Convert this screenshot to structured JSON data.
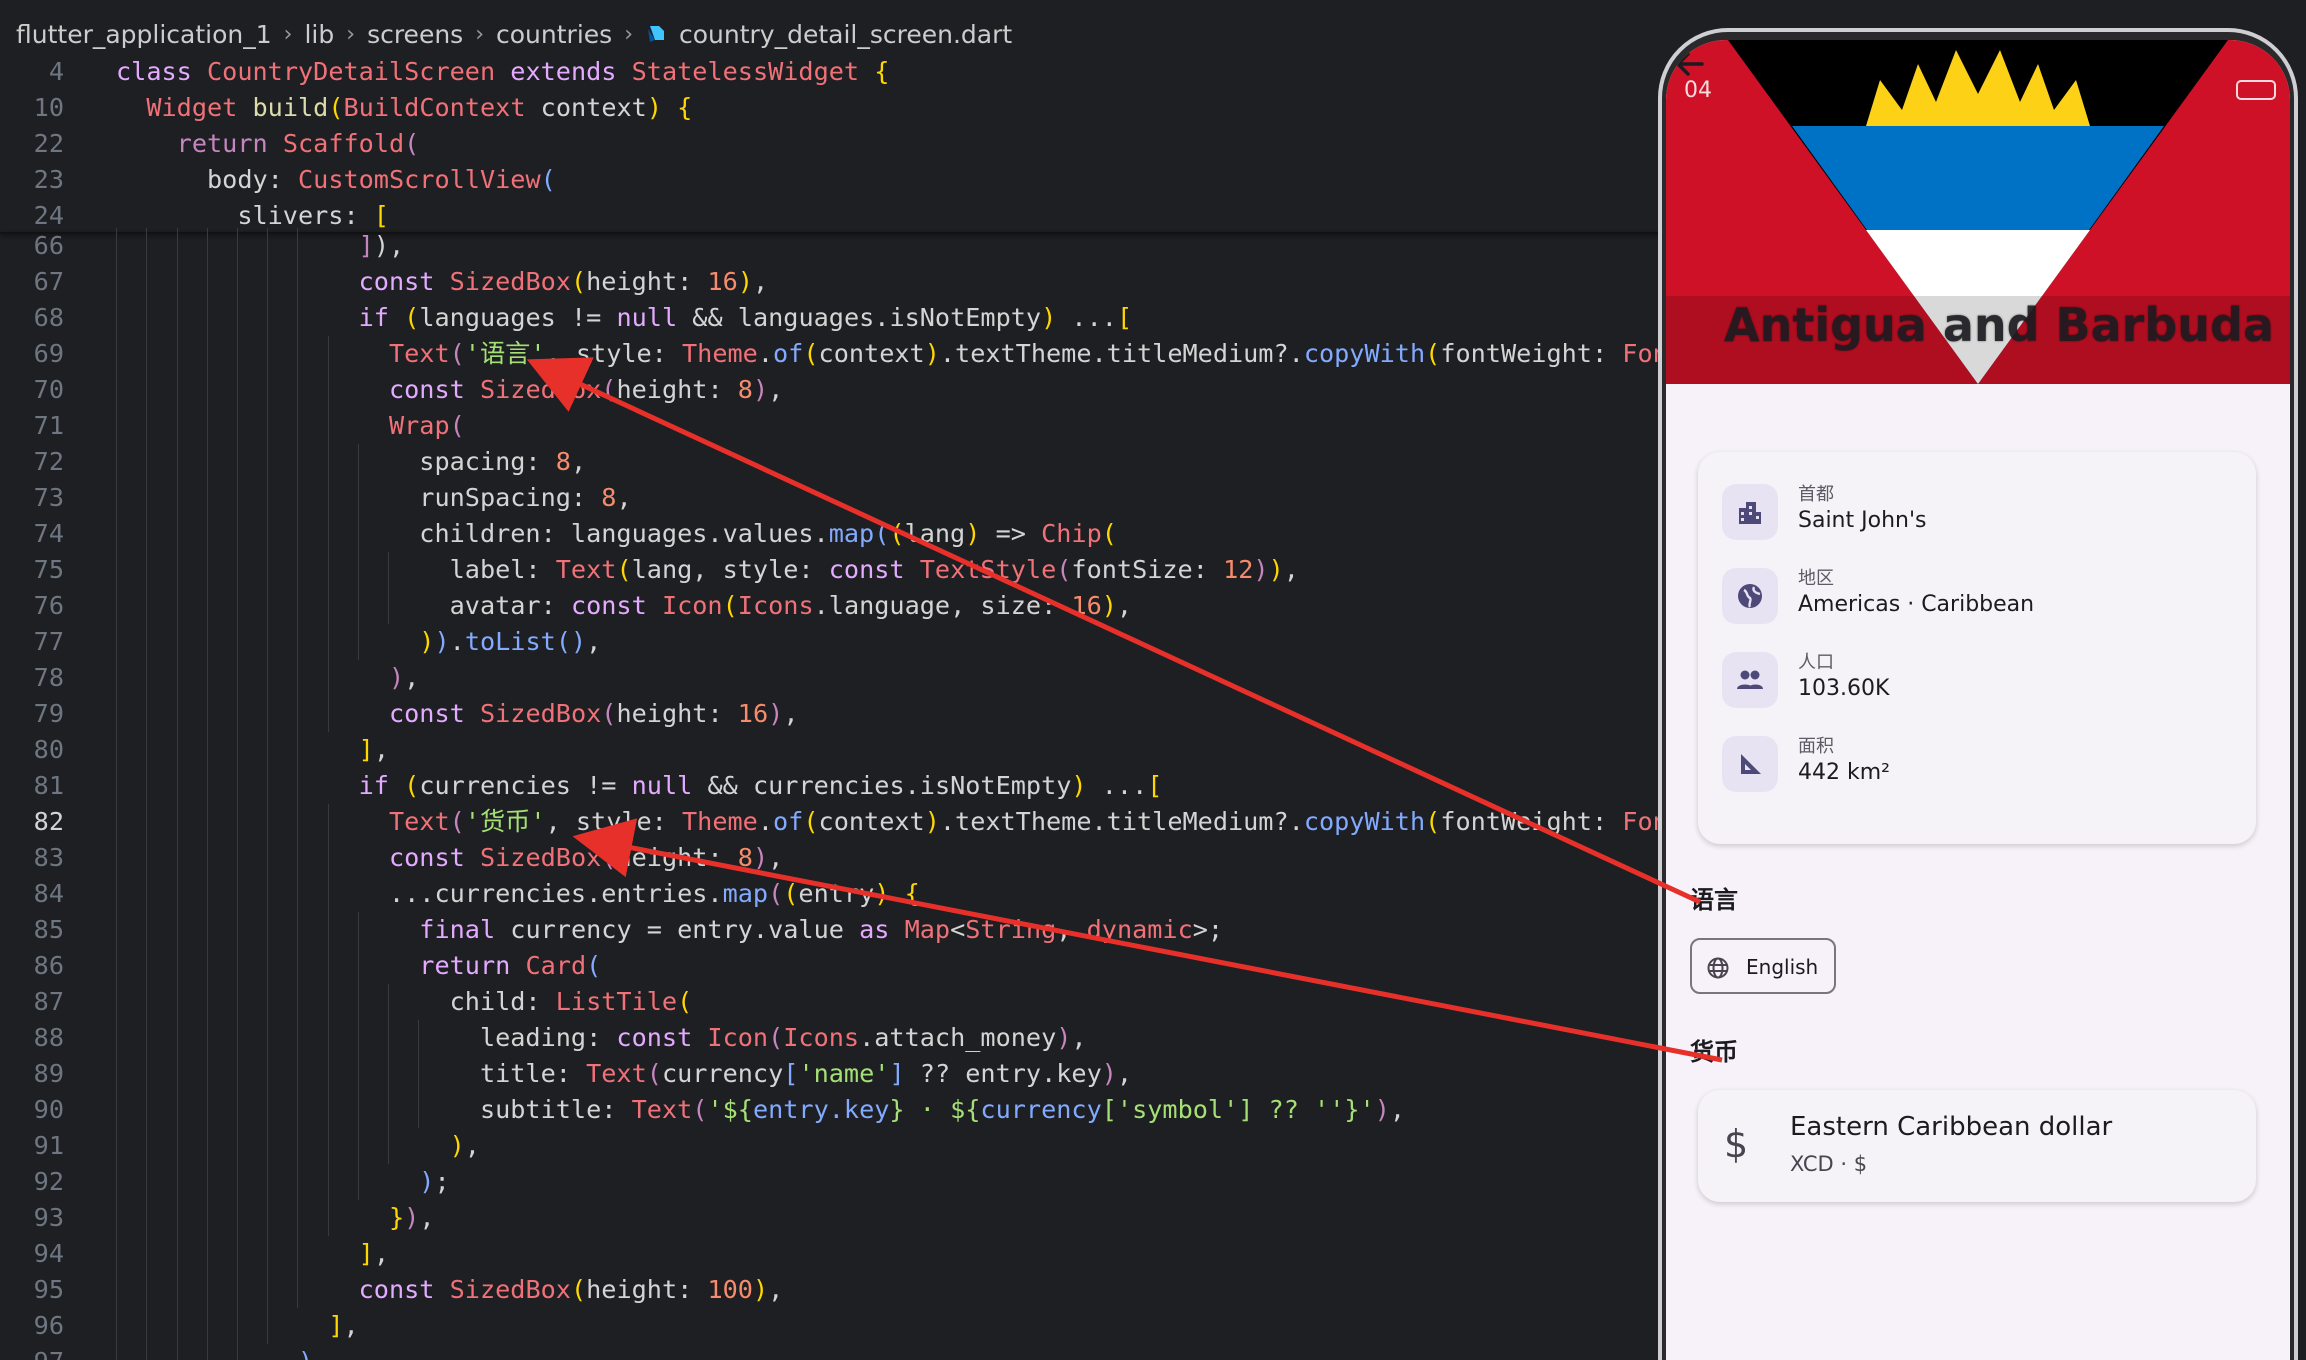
{
  "breadcrumb": {
    "parts": [
      "flutter_application_1",
      "lib",
      "screens",
      "countries"
    ],
    "file": "country_detail_screen.dart"
  },
  "sticky_lines": [
    {
      "n": "4",
      "html": "<span class='pk'>class</span> <span class='c'>CountryDetailScreen</span> <span class='pk'>extends</span> <span class='c'>StatelessWidget</span> <span class='b'>{</span>"
    },
    {
      "n": "10",
      "html": "  <span class='c'>Widget</span> <span class='t'>build</span><span class='b'>(</span><span class='c'>BuildContext</span> context<span class='b'>)</span> <span class='b'>{</span>"
    },
    {
      "n": "22",
      "html": "    <span class='k'>return</span> <span class='c'>Scaffold</span><span class='k'>(</span>"
    },
    {
      "n": "23",
      "html": "      body: <span class='c'>CustomScrollView</span><span class='m'>(</span>"
    },
    {
      "n": "24",
      "html": "        slivers: <span class='b'>[</span>"
    }
  ],
  "code_lines": [
    {
      "n": "66",
      "html": "                <span class='k'>]</span>),"
    },
    {
      "n": "67",
      "html": "                <span class='pk'>const</span> <span class='c'>SizedBox</span><span class='b'>(</span>height: <span class='n'>16</span><span class='b'>)</span>,"
    },
    {
      "n": "68",
      "html": "                <span class='pk'>if</span> <span class='b'>(</span>languages != <span class='pk'>null</span> &amp;&amp; languages.isNotEmpty<span class='b'>)</span> ...<span class='b'>[</span>"
    },
    {
      "n": "69",
      "html": "                  <span class='c'>Text</span><span class='k'>(</span><span class='s'>'语言'</span>, style: <span class='c'>Theme</span>.<span class='m'>of</span><span class='b'>(</span>context<span class='b'>)</span>.textTheme.titleMedium?.<span class='m'>copyWith</span><span class='b'>(</span>fontWeight: <span class='c'>FontWeight</span>"
    },
    {
      "n": "70",
      "html": "                  <span class='pk'>const</span> <span class='c'>SizedBox</span><span class='k'>(</span>height: <span class='n'>8</span><span class='k'>)</span>,"
    },
    {
      "n": "71",
      "html": "                  <span class='c'>Wrap</span><span class='k'>(</span>"
    },
    {
      "n": "72",
      "html": "                    spacing: <span class='n'>8</span>,"
    },
    {
      "n": "73",
      "html": "                    runSpacing: <span class='n'>8</span>,"
    },
    {
      "n": "74",
      "html": "                    children: languages.values.<span class='m'>map</span><span class='m'>(</span><span class='b'>(</span>lang<span class='b'>)</span> =&gt; <span class='c'>Chip</span><span class='b'>(</span>"
    },
    {
      "n": "75",
      "html": "                      label: <span class='c'>Text</span><span class='b'>(</span>lang, style: <span class='pk'>const</span> <span class='c'>TextStyle</span><span class='k'>(</span>fontSize: <span class='n'>12</span><span class='k'>)</span><span class='b'>)</span>,"
    },
    {
      "n": "76",
      "html": "                      avatar: <span class='pk'>const</span> <span class='c'>Icon</span><span class='b'>(</span><span class='c'>Icons</span>.language, size: <span class='n'>16</span><span class='b'>)</span>,"
    },
    {
      "n": "77",
      "html": "                    <span class='b'>)</span><span class='m'>)</span>.<span class='m'>toList</span><span class='m'>()</span>,"
    },
    {
      "n": "78",
      "html": "                  <span class='k'>)</span>,"
    },
    {
      "n": "79",
      "html": "                  <span class='pk'>const</span> <span class='c'>SizedBox</span><span class='k'>(</span>height: <span class='n'>16</span><span class='k'>)</span>,"
    },
    {
      "n": "80",
      "html": "                <span class='b'>]</span>,"
    },
    {
      "n": "81",
      "html": "                <span class='pk'>if</span> <span class='b'>(</span>currencies != <span class='pk'>null</span> &amp;&amp; currencies.isNotEmpty<span class='b'>)</span> ...<span class='b'>[</span>"
    },
    {
      "n": "82",
      "html": "                  <span class='c'>Text</span><span class='k'>(</span><span class='s'>'货币'</span>, style: <span class='c'>Theme</span>.<span class='m'>of</span><span class='b'>(</span>context<span class='b'>)</span>.textTheme.titleMedium?.<span class='m'>copyWith</span><span class='b'>(</span>fontWeight: <span class='c'>FontWeight</span>",
      "current": true
    },
    {
      "n": "83",
      "html": "                  <span class='pk'>const</span> <span class='c'>SizedBox</span><span class='k'>(</span>height: <span class='n'>8</span><span class='k'>)</span>,"
    },
    {
      "n": "84",
      "html": "                  ...currencies.entries.<span class='m'>map</span><span class='k'>(</span><span class='b'>(</span>entry<span class='b'>)</span> <span class='b'>{</span>"
    },
    {
      "n": "85",
      "html": "                    <span class='pk'>final</span> currency = entry.value <span class='pk'>as</span> <span class='c'>Map</span>&lt;<span class='c'>String</span>, <span class='c'>dynamic</span>&gt;;"
    },
    {
      "n": "86",
      "html": "                    <span class='pk'>return</span> <span class='c'>Card</span><span class='m'>(</span>"
    },
    {
      "n": "87",
      "html": "                      child: <span class='c'>ListTile</span><span class='b'>(</span>"
    },
    {
      "n": "88",
      "html": "                        leading: <span class='pk'>const</span> <span class='c'>Icon</span><span class='k'>(</span><span class='c'>Icons</span>.attach_money<span class='k'>)</span>,"
    },
    {
      "n": "89",
      "html": "                        title: <span class='c'>Text</span><span class='k'>(</span>currency<span class='m'>[</span><span class='s'>'name'</span><span class='m'>]</span> ?? entry.key<span class='k'>)</span>,"
    },
    {
      "n": "90",
      "html": "                        subtitle: <span class='c'>Text</span><span class='k'>(</span><span class='s'>'${</span><span class='m'>entry.key</span><span class='s'>} · ${</span><span class='m'>currency</span><span class='s'>['symbol'] ?? ''}'</span><span class='k'>)</span>,"
    },
    {
      "n": "91",
      "html": "                      <span class='b'>)</span>,"
    },
    {
      "n": "92",
      "html": "                    <span class='m'>)</span>;"
    },
    {
      "n": "93",
      "html": "                  <span class='b'>}</span><span class='k'>)</span>,"
    },
    {
      "n": "94",
      "html": "                <span class='b'>]</span>,"
    },
    {
      "n": "95",
      "html": "                <span class='pk'>const</span> <span class='c'>SizedBox</span><span class='b'>(</span>height: <span class='n'>100</span><span class='b'>)</span>,"
    },
    {
      "n": "96",
      "html": "              <span class='b'>]</span>,"
    },
    {
      "n": "97",
      "html": "            <span class='m'>)</span>,"
    }
  ],
  "phone": {
    "status_time": "04",
    "country_name": "Antigua and Barbuda",
    "info": [
      {
        "icon": "city-icon",
        "label": "首都",
        "value": "Saint John's"
      },
      {
        "icon": "globe-icon",
        "label": "地区",
        "value": "Americas · Caribbean"
      },
      {
        "icon": "people-icon",
        "label": "人口",
        "value": "103.60K"
      },
      {
        "icon": "area-icon",
        "label": "面积",
        "value": "442 km²"
      }
    ],
    "languages_heading": "语言",
    "language_chip": "English",
    "currencies_heading": "货币",
    "currency_name": "Eastern Caribbean dollar",
    "currency_sub": "XCD · $"
  },
  "colors": {
    "editor_bg": "#1e1f22",
    "annotation_arrow": "#e8302a",
    "flag_red": "#ce1126",
    "flag_blue": "#0072c6",
    "flag_gold": "#fcd116"
  }
}
